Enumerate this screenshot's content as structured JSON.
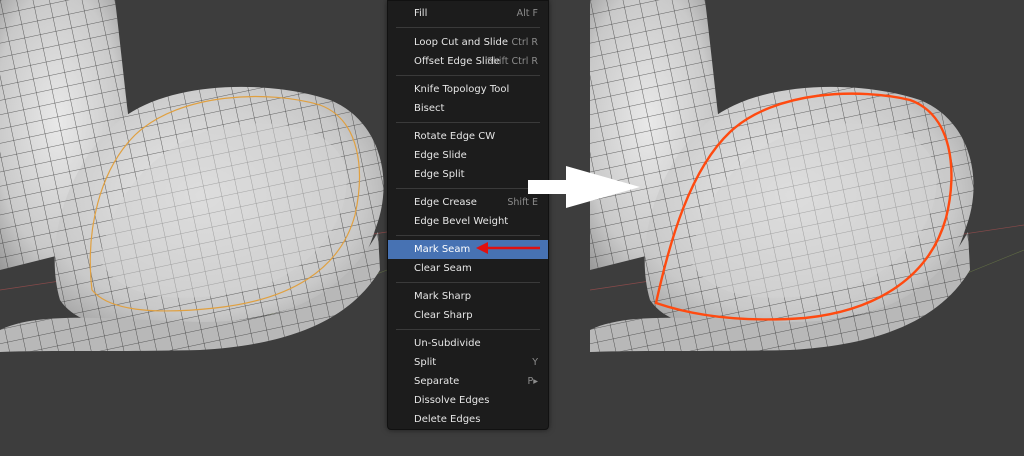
{
  "context_menu": {
    "items": [
      {
        "label": "Fill",
        "shortcut": "Alt F"
      },
      {
        "label": "Loop Cut and Slide",
        "shortcut": "Ctrl R"
      },
      {
        "label": "Offset Edge Slide",
        "shortcut": "Shift Ctrl R"
      },
      {
        "label": "Knife Topology Tool",
        "shortcut": ""
      },
      {
        "label": "Bisect",
        "shortcut": ""
      },
      {
        "label": "Rotate Edge CW",
        "shortcut": ""
      },
      {
        "label": "Edge Slide",
        "shortcut": ""
      },
      {
        "label": "Edge Split",
        "shortcut": ""
      },
      {
        "label": "Edge Crease",
        "shortcut": "Shift E"
      },
      {
        "label": "Edge Bevel Weight",
        "shortcut": ""
      },
      {
        "label": "Mark Seam",
        "shortcut": ""
      },
      {
        "label": "Clear Seam",
        "shortcut": ""
      },
      {
        "label": "Mark Sharp",
        "shortcut": ""
      },
      {
        "label": "Clear Sharp",
        "shortcut": ""
      },
      {
        "label": "Un-Subdivide",
        "shortcut": ""
      },
      {
        "label": "Split",
        "shortcut": "Y"
      },
      {
        "label": "Separate",
        "shortcut": "P▸"
      },
      {
        "label": "Dissolve Edges",
        "shortcut": ""
      },
      {
        "label": "Delete Edges",
        "shortcut": ""
      }
    ],
    "highlighted": "Mark Seam"
  },
  "colors": {
    "viewport_bg": "#3d3d3d",
    "menu_bg": "#1c1c1c",
    "highlight": "#4772b3",
    "seam_selected_before": "#e0a040",
    "seam_marked_after": "#ff4a10",
    "annotation_arrow": "#e01010"
  },
  "icons": {
    "transition_arrow": "white-right-arrow-icon",
    "pointer_arrow": "red-left-arrow-icon"
  }
}
